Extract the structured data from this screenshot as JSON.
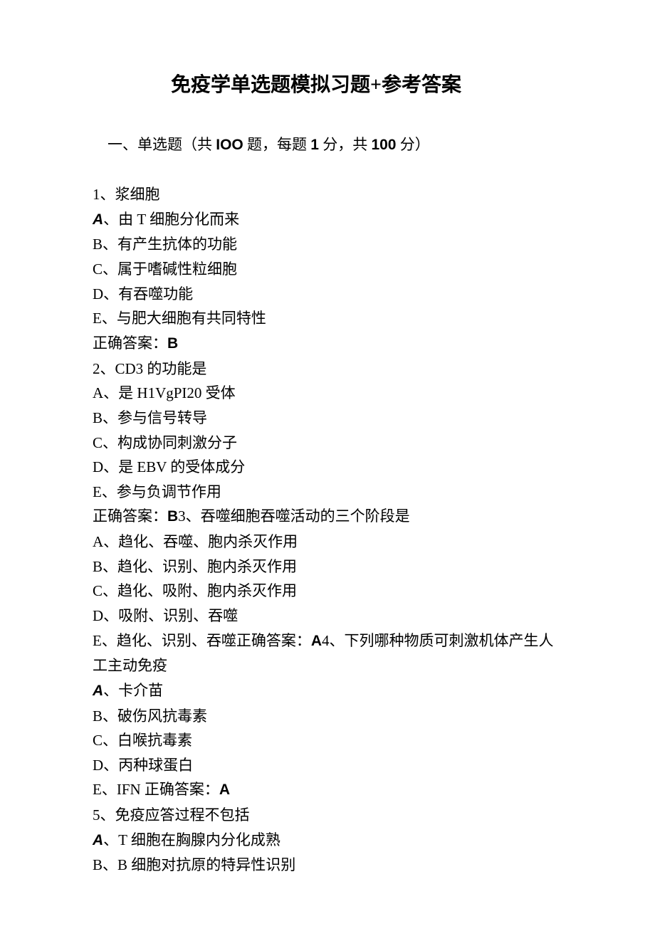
{
  "title": "免疫学单选题模拟习题+参考答案",
  "section_header_prefix": "一、单选题（共 ",
  "section_header_ioo": "IOO",
  "section_header_mid1": " 题，每题 ",
  "section_header_points": "1",
  "section_header_mid2": " 分，共 ",
  "section_header_total": "100",
  "section_header_suffix": " 分）",
  "q1": {
    "num": "1、浆细胞",
    "a_pre": "A",
    "a": "、由 T 细胞分化而来",
    "b": "B、有产生抗体的功能",
    "c": "C、属于嗜碱性粒细胞",
    "d": "D、有吞噬功能",
    "e": "E、与肥大细胞有共同特性",
    "ans_label": "正确答案：",
    "ans": "B"
  },
  "q2": {
    "num": "2、CD3 的功能是",
    "a": "A、是 H1VgPI20 受体",
    "b": "B、参与信号转导",
    "c": "C、构成协同刺激分子",
    "d": "D、是 EBV 的受体成分",
    "e": "E、参与负调节作用",
    "ans_label": "正确答案：",
    "ans": "B"
  },
  "q3": {
    "num": "3、吞噬细胞吞噬活动的三个阶段是",
    "a": "A、趋化、吞噬、胞内杀灭作用",
    "b": "B、趋化、识别、胞内杀灭作用",
    "c": "C、趋化、吸附、胞内杀灭作用",
    "d": "D、吸附、识别、吞噬",
    "e": "E、趋化、识别、吞噬正确答案：",
    "e_ans": "A"
  },
  "q4": {
    "num": "4、下列哪种物质可刺激机体产生人工主动免疫",
    "a_pre": "A",
    "a": "、卡介苗",
    "b": "B、破伤风抗毒素",
    "c": "C、白喉抗毒素",
    "d": "D、丙种球蛋白",
    "e": "E、IFN 正确答案：",
    "e_ans": "A"
  },
  "q5": {
    "num": "5、免疫应答过程不包括",
    "a_pre": "A",
    "a": "、T 细胞在胸腺内分化成熟",
    "b": "B、B 细胞对抗原的特异性识别"
  }
}
